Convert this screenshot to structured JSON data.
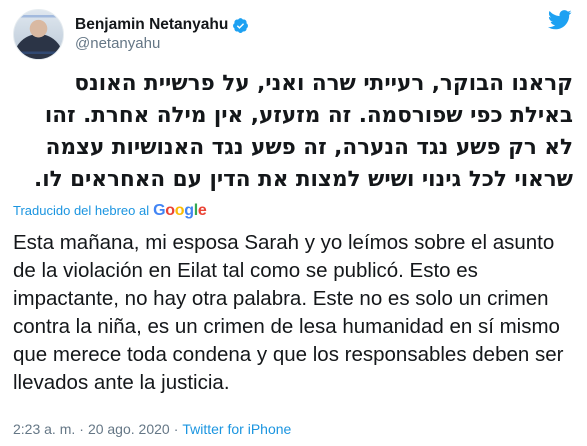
{
  "tweet": {
    "display_name": "Benjamin Netanyahu",
    "handle": "@netanyahu",
    "verified": true,
    "icons": {
      "verified": "verified-badge-icon",
      "brand": "twitter-bird-icon"
    },
    "text_hebrew": "קראנו הבוקר, רעייתי שרה ואני, על פרשיית האונס באילת כפי שפורסמה. זה מזעזע, אין מילה אחרת. זהו לא רק פשע נגד הנערה, זה פשע נגד האנושיות עצמה שראוי לכל גינוי ושיש למצות את הדין עם האחראים לו.",
    "translated_label": "Traducido del hebreo al",
    "google_letters": [
      "G",
      "o",
      "o",
      "g",
      "l",
      "e"
    ],
    "text_spanish": "Esta mañana, mi esposa Sarah y yo leímos sobre el asunto de la violación en Eilat tal como se publicó. Esto es impactante, no hay otra palabra. Este no es solo un crimen contra la niña, es un crimen de lesa humanidad en sí mismo que merece toda condena y que los responsables deben ser llevados ante la justicia.",
    "time": "2:23 a. m.",
    "separator": "·",
    "date": "20 ago. 2020",
    "source": "Twitter for iPhone"
  },
  "colors": {
    "link": "#1b95e0",
    "secondary_text": "#657786",
    "primary_text": "#14171a",
    "verified_badge": "#1da1f2"
  }
}
